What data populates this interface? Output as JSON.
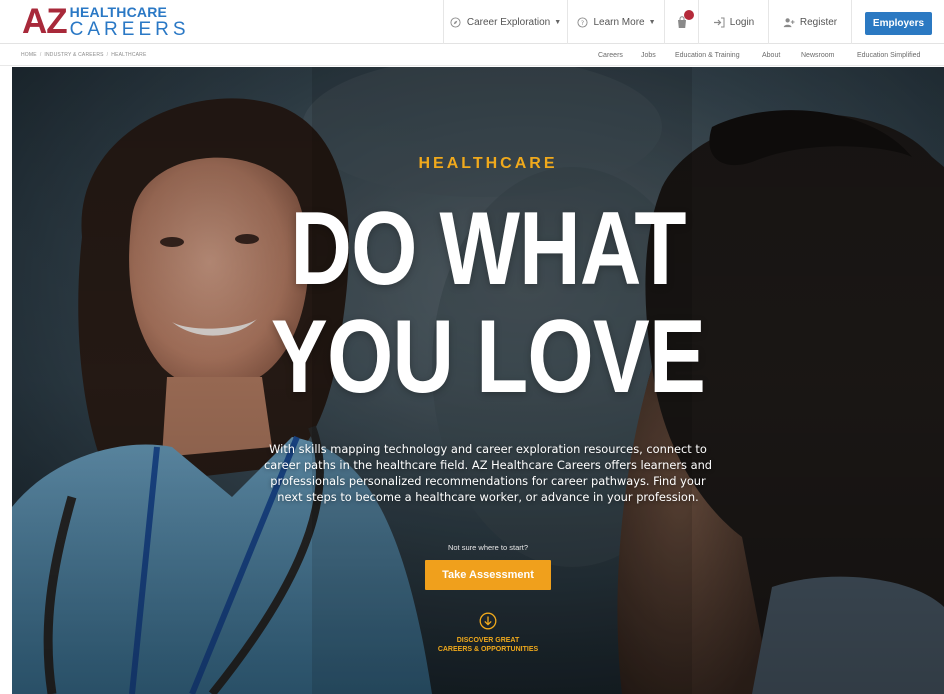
{
  "header": {
    "logo": {
      "initials": "AZ",
      "top_word": "HEALTHCARE",
      "bottom_word": "CAREERS"
    },
    "nav": {
      "career_exploration": "Career Exploration",
      "learn_more": "Learn More",
      "login": "Login",
      "register": "Register",
      "employers": "Employers"
    },
    "icons": {
      "career_exploration": "compass-icon",
      "learn_more": "question-circle-icon",
      "notifications": "shopping-bag-icon",
      "login": "sign-in-icon",
      "register": "user-plus-icon",
      "dropdown": "caret-down-icon"
    }
  },
  "subheader": {
    "breadcrumb": [
      "HOME",
      "INDUSTRY & CAREERS",
      "HEALTHCARE"
    ],
    "links": {
      "careers": "Careers",
      "jobs": "Jobs",
      "education_training": "Education & Training",
      "about": "About",
      "newsroom": "Newsroom",
      "education_simplified": "Education Simplified"
    }
  },
  "hero": {
    "kicker": "HEALTHCARE",
    "title_line1": "DO WHAT",
    "title_line2": "YOU LOVE",
    "description": "With skills mapping technology and career exploration resources, connect to career paths in the healthcare field. AZ Healthcare Careers offers learners and professionals personalized recommendations for career pathways. Find your next steps to become a healthcare worker, or advance in your profession.",
    "prompt": "Not sure where to start?",
    "button": "Take Assessment",
    "discover_line1": "DISCOVER GREAT",
    "discover_line2": "CAREERS & OPPORTUNITIES",
    "discover_icon": "arrow-down-circle-icon"
  },
  "colors": {
    "brand_red": "#a8293a",
    "brand_blue": "#2a78c5",
    "accent_orange": "#f0a01c",
    "employers_blue": "#2b79c2"
  }
}
